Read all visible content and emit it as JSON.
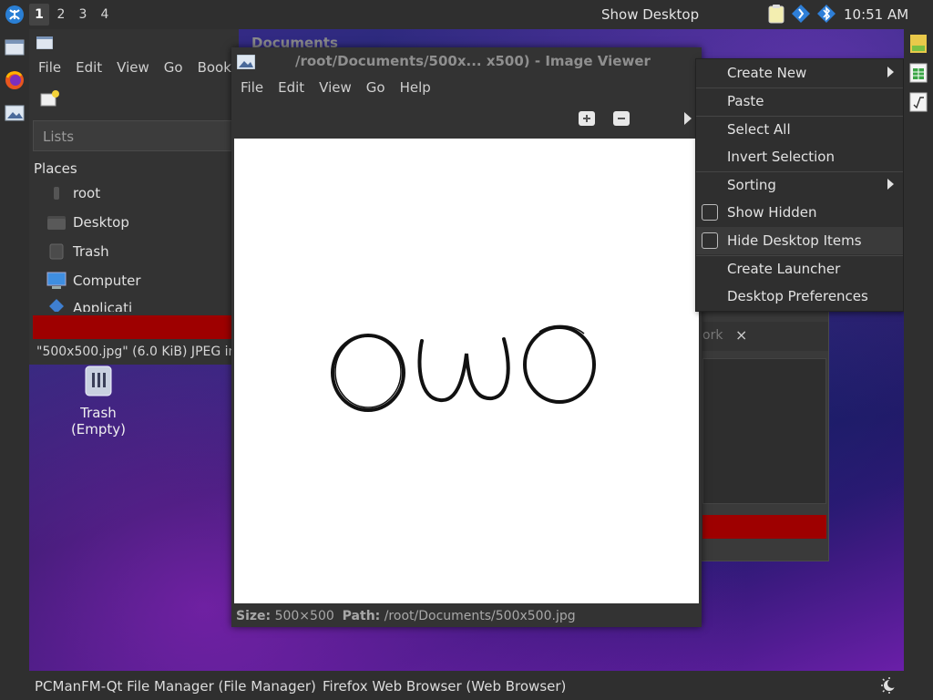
{
  "top_panel": {
    "workspaces": [
      "1",
      "2",
      "3",
      "4"
    ],
    "active_workspace": "1",
    "show_desktop_label": "Show Desktop",
    "clock": "10:51 AM"
  },
  "file_manager": {
    "title": "Documents",
    "menu": [
      "File",
      "Edit",
      "View",
      "Go",
      "Bookr"
    ],
    "lists_label": "Lists",
    "places_header": "Places",
    "places": [
      {
        "label": "root",
        "icon": "home-icon"
      },
      {
        "label": "Desktop",
        "icon": "folder-icon"
      },
      {
        "label": "Trash",
        "icon": "trash-icon"
      },
      {
        "label": "Computer",
        "icon": "computer-icon"
      },
      {
        "label": "Applicati",
        "icon": "applications-icon"
      }
    ],
    "status": "\"500x500.jpg\" (6.0 KiB) JPEG im"
  },
  "desktop": {
    "trash_label": "Trash (Empty)"
  },
  "background_dialog": {
    "tab_label": "ork",
    "tab_close": "×"
  },
  "image_viewer": {
    "title": "/root/Documents/500x... x500) - Image Viewer",
    "menu": [
      "File",
      "Edit",
      "View",
      "Go",
      "Help"
    ],
    "image_text": "OWO",
    "status_size_label": "Size:",
    "status_size_value": "500×500",
    "status_path_label": "Path:",
    "status_path_value": "/root/Documents/500x500.jpg"
  },
  "context_menu": {
    "items": [
      {
        "label": "Create New",
        "submenu": true
      },
      {
        "label": "Paste"
      },
      {
        "label": "Select All"
      },
      {
        "label": "Invert Selection"
      },
      {
        "label": "Sorting",
        "submenu": true
      },
      {
        "label": "Show Hidden",
        "checkbox": true,
        "checked": false
      },
      {
        "label": "Hide Desktop Items",
        "checkbox": true,
        "checked": false
      },
      {
        "label": "Create Launcher"
      },
      {
        "label": "Desktop Preferences"
      }
    ]
  },
  "taskbar": {
    "tasks": [
      "PCManFM-Qt File Manager (File Manager)",
      "Firefox Web Browser (Web Browser)"
    ]
  },
  "colors": {
    "panel_bg": "#2f2f2f",
    "accent_red": "#9e0000",
    "window_bg": "#333333"
  }
}
